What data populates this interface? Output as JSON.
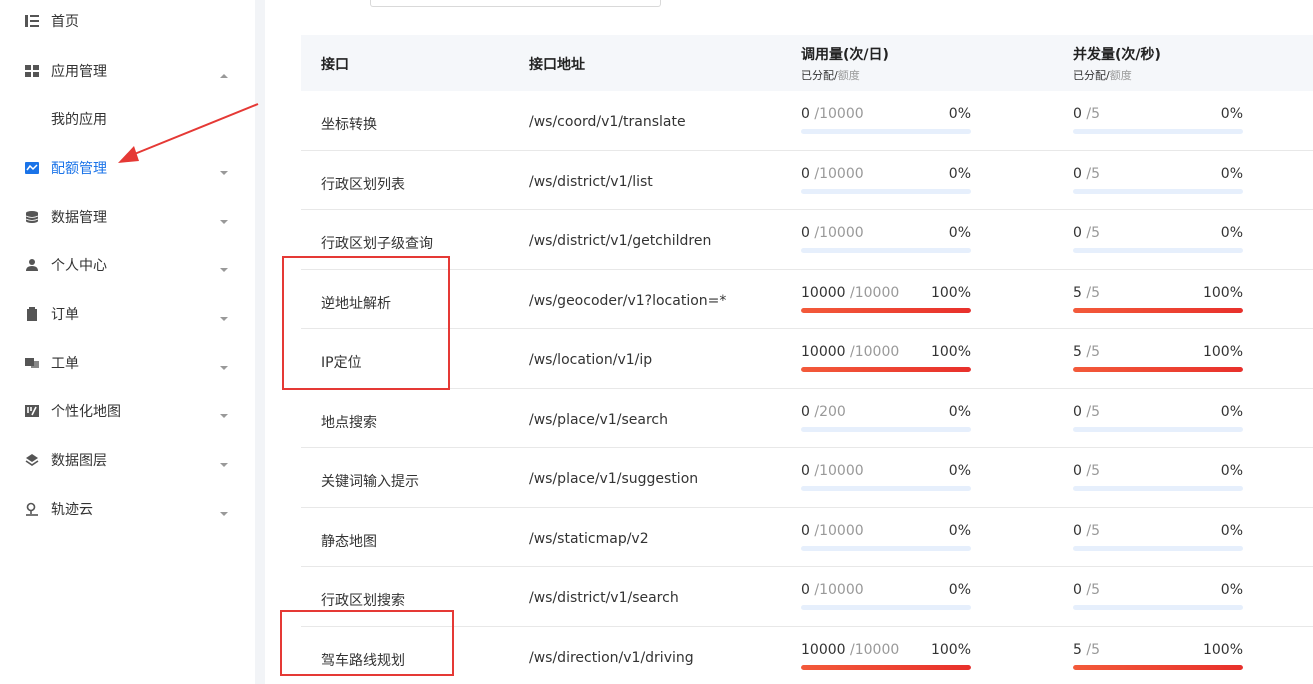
{
  "sidebar": {
    "items": [
      {
        "label": "首页",
        "icon": "home-list-icon",
        "chevron": false,
        "active": false
      },
      {
        "label": "应用管理",
        "icon": "grid-icon",
        "chevron": "up",
        "active": false
      },
      {
        "label": "我的应用",
        "icon": null,
        "chevron": false,
        "active": false,
        "sub": true
      },
      {
        "label": "配额管理",
        "icon": "chart-line-icon",
        "chevron": "down",
        "active": true
      },
      {
        "label": "数据管理",
        "icon": "database-icon",
        "chevron": "down",
        "active": false
      },
      {
        "label": "个人中心",
        "icon": "user-icon",
        "chevron": "down",
        "active": false
      },
      {
        "label": "订单",
        "icon": "clipboard-icon",
        "chevron": "down",
        "active": false
      },
      {
        "label": "工单",
        "icon": "ticket-icon",
        "chevron": "down",
        "active": false
      },
      {
        "label": "个性化地图",
        "icon": "custom-map-icon",
        "chevron": "down",
        "active": false
      },
      {
        "label": "数据图层",
        "icon": "layers-icon",
        "chevron": "down",
        "active": false
      },
      {
        "label": "轨迹云",
        "icon": "track-icon",
        "chevron": "down",
        "active": false
      }
    ]
  },
  "table": {
    "headers": {
      "api": "接口",
      "url": "接口地址",
      "calls": "调用量(次/日)",
      "calls_sub_a": "已分配/",
      "calls_sub_b": "额度",
      "concurrency": "并发量(次/秒)",
      "concurrency_sub_a": "已分配/",
      "concurrency_sub_b": "额度"
    },
    "rows": [
      {
        "name": "坐标转换",
        "url": "/ws/coord/v1/translate",
        "calls_used": "0",
        "calls_quota": "/10000",
        "calls_pct": "0%",
        "calls_fill": 0,
        "conc_used": "0",
        "conc_quota": "/5",
        "conc_pct": "0%",
        "conc_fill": 0
      },
      {
        "name": "行政区划列表",
        "url": "/ws/district/v1/list",
        "calls_used": "0",
        "calls_quota": "/10000",
        "calls_pct": "0%",
        "calls_fill": 0,
        "conc_used": "0",
        "conc_quota": "/5",
        "conc_pct": "0%",
        "conc_fill": 0
      },
      {
        "name": "行政区划子级查询",
        "url": "/ws/district/v1/getchildren",
        "calls_used": "0",
        "calls_quota": "/10000",
        "calls_pct": "0%",
        "calls_fill": 0,
        "conc_used": "0",
        "conc_quota": "/5",
        "conc_pct": "0%",
        "conc_fill": 0
      },
      {
        "name": "逆地址解析",
        "url": "/ws/geocoder/v1?location=*",
        "calls_used": "10000",
        "calls_quota": "/10000",
        "calls_pct": "100%",
        "calls_fill": 1,
        "conc_used": "5",
        "conc_quota": "/5",
        "conc_pct": "100%",
        "conc_fill": 1
      },
      {
        "name": "IP定位",
        "url": "/ws/location/v1/ip",
        "calls_used": "10000",
        "calls_quota": "/10000",
        "calls_pct": "100%",
        "calls_fill": 1,
        "conc_used": "5",
        "conc_quota": "/5",
        "conc_pct": "100%",
        "conc_fill": 1
      },
      {
        "name": "地点搜索",
        "url": "/ws/place/v1/search",
        "calls_used": "0",
        "calls_quota": "/200",
        "calls_pct": "0%",
        "calls_fill": 0,
        "conc_used": "0",
        "conc_quota": "/5",
        "conc_pct": "0%",
        "conc_fill": 0
      },
      {
        "name": "关键词输入提示",
        "url": "/ws/place/v1/suggestion",
        "calls_used": "0",
        "calls_quota": "/10000",
        "calls_pct": "0%",
        "calls_fill": 0,
        "conc_used": "0",
        "conc_quota": "/5",
        "conc_pct": "0%",
        "conc_fill": 0
      },
      {
        "name": "静态地图",
        "url": "/ws/staticmap/v2",
        "calls_used": "0",
        "calls_quota": "/10000",
        "calls_pct": "0%",
        "calls_fill": 0,
        "conc_used": "0",
        "conc_quota": "/5",
        "conc_pct": "0%",
        "conc_fill": 0
      },
      {
        "name": "行政区划搜索",
        "url": "/ws/district/v1/search",
        "calls_used": "0",
        "calls_quota": "/10000",
        "calls_pct": "0%",
        "calls_fill": 0,
        "conc_used": "0",
        "conc_quota": "/5",
        "conc_pct": "0%",
        "conc_fill": 0
      },
      {
        "name": "驾车路线规划",
        "url": "/ws/direction/v1/driving",
        "calls_used": "10000",
        "calls_quota": "/10000",
        "calls_pct": "100%",
        "calls_fill": 1,
        "conc_used": "5",
        "conc_quota": "/5",
        "conc_pct": "100%",
        "conc_fill": 1
      }
    ]
  },
  "colors": {
    "accent": "#1a73e8",
    "annotation": "#e53935",
    "bar_track": "#e6effc",
    "bar_fill": "#e8302b"
  }
}
